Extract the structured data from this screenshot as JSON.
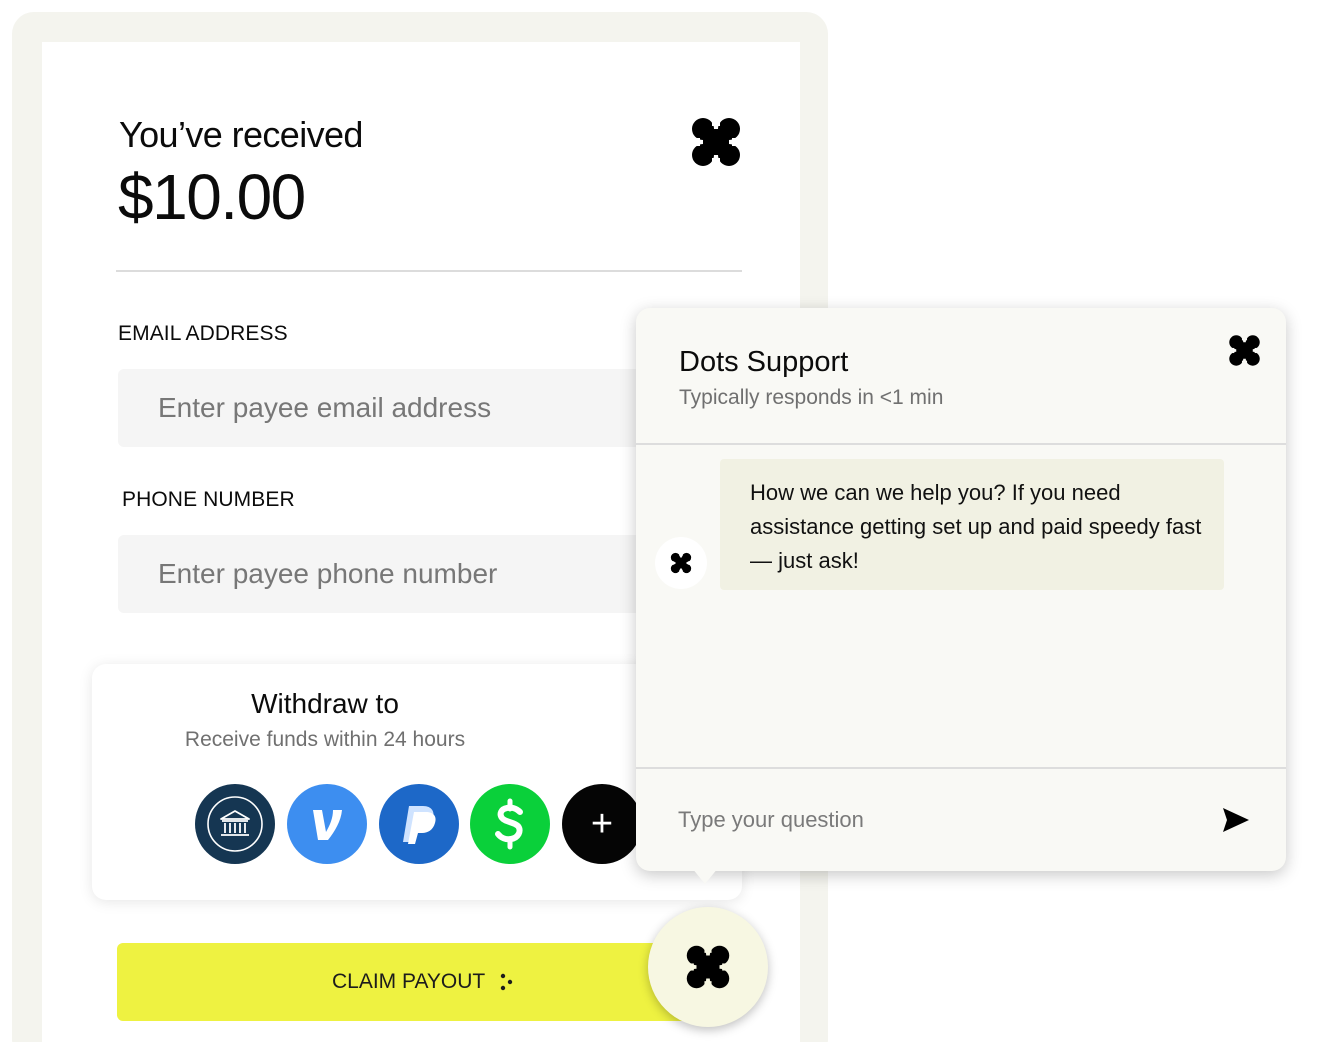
{
  "payout": {
    "received_label": "You’ve received",
    "amount": "$10.00",
    "brand_icon": "dots-logo-icon"
  },
  "form": {
    "email_label": "EMAIL ADDRESS",
    "email_placeholder": "Enter payee email address",
    "phone_label": "PHONE NUMBER",
    "phone_placeholder": "Enter payee phone number"
  },
  "withdraw": {
    "title": "Withdraw to",
    "subtitle": "Receive funds within 24 hours",
    "methods": [
      {
        "icon": "bank-icon",
        "color": "#153652"
      },
      {
        "icon": "venmo-icon",
        "color": "#3d8ef0"
      },
      {
        "icon": "paypal-icon",
        "color": "#1d68c8"
      },
      {
        "icon": "cash-app-icon",
        "color": "#0ad03a"
      },
      {
        "icon": "plus-icon",
        "color": "#050505",
        "label": "+"
      }
    ]
  },
  "claim": {
    "label": "CLAIM PAYOUT",
    "color": "#eef241"
  },
  "chat": {
    "title": "Dots Support",
    "subtitle": "Typically responds in <1 min",
    "message": "How we can we help you? If you need assistance getting set up and paid speedy fast — just ask!",
    "input_placeholder": "Type your question",
    "send_icon": "send-icon"
  }
}
